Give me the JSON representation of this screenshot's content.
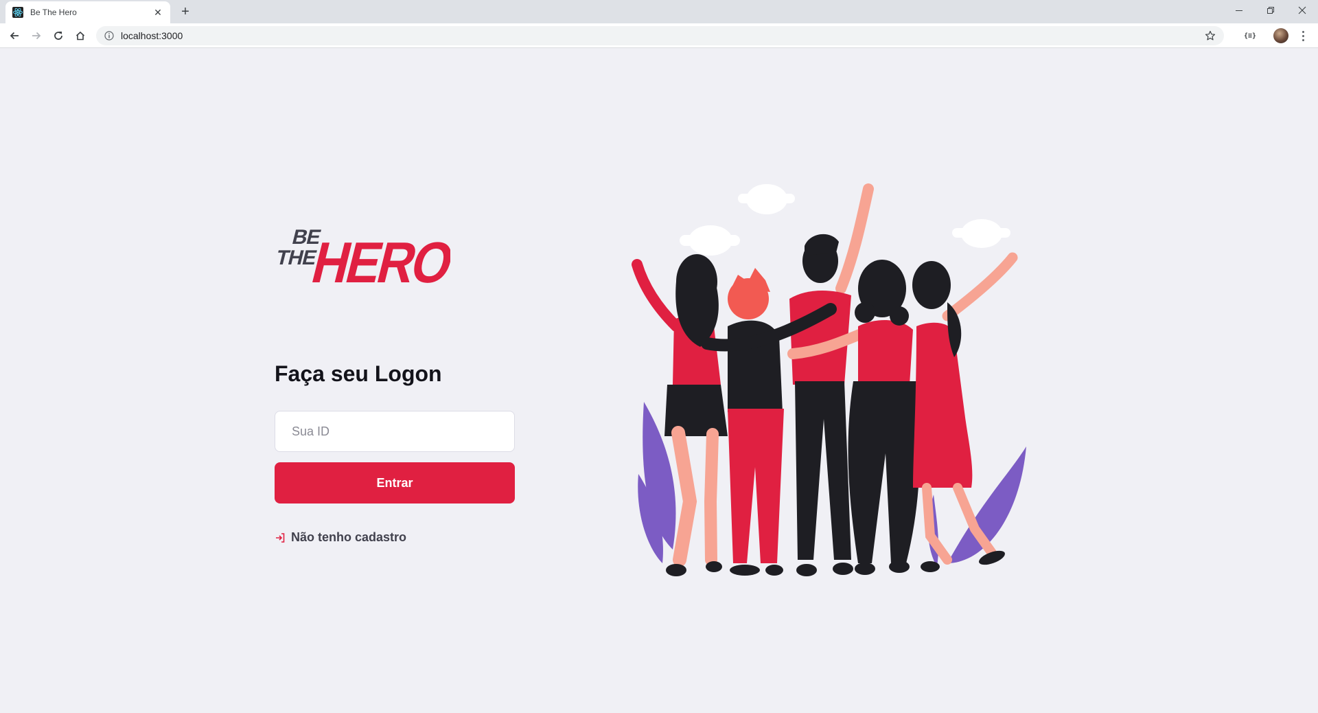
{
  "browser": {
    "tab_title": "Be The Hero",
    "new_tab_symbol": "+",
    "url": "localhost:3000",
    "extension_label": "{≡}"
  },
  "logo": {
    "small_line1": "BE",
    "small_line2": "THE",
    "big_word": "HERO",
    "colors": {
      "dark": "#41414d",
      "red": "#e02041"
    }
  },
  "login": {
    "title": "Faça seu Logon",
    "id_placeholder": "Sua ID",
    "id_value": "",
    "submit_label": "Entrar",
    "register_link_label": "Não tenho cadastro",
    "register_icon": "log-in-icon"
  },
  "theme": {
    "background": "#f0f0f5",
    "accent": "#e02041",
    "text": "#13131a",
    "purple_leaves": "#7c5cc4"
  }
}
